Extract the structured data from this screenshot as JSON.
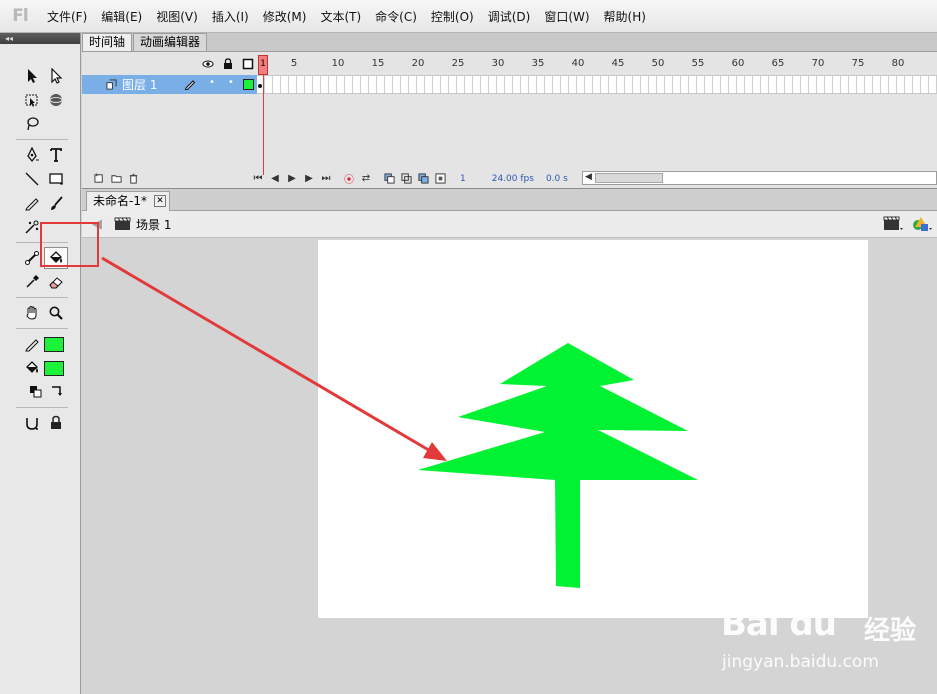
{
  "app": {
    "logo": "Fl"
  },
  "menu": {
    "items": [
      "文件(F)",
      "编辑(E)",
      "视图(V)",
      "插入(I)",
      "修改(M)",
      "文本(T)",
      "命令(C)",
      "控制(O)",
      "调试(D)",
      "窗口(W)",
      "帮助(H)"
    ]
  },
  "tools": {
    "collapse_glyph": "◂◂"
  },
  "timeline": {
    "tabs": [
      "时间轴",
      "动画编辑器"
    ],
    "layer_name": "图层 1",
    "ruler_numbers": [
      "1",
      "5",
      "10",
      "15",
      "20",
      "25",
      "30",
      "35",
      "40",
      "45",
      "50",
      "55",
      "60",
      "65",
      "70",
      "75",
      "80"
    ],
    "playhead_frame": "1",
    "current_frame": "1",
    "fps": "24.00 fps",
    "time": "0.0 s"
  },
  "document": {
    "tab_title": "未命名-1*",
    "tab_close": "✕",
    "scene_name": "场景 1"
  },
  "colors": {
    "stroke": "#1cf23a",
    "fill": "#1cf23a",
    "tree": "#00f233",
    "annotation": "#e23a3a",
    "layer_selected": "#7aaee6"
  },
  "watermark": {
    "logo": "Bai du",
    "brand_cn": "经验",
    "url": "jingyan.baidu.com"
  }
}
